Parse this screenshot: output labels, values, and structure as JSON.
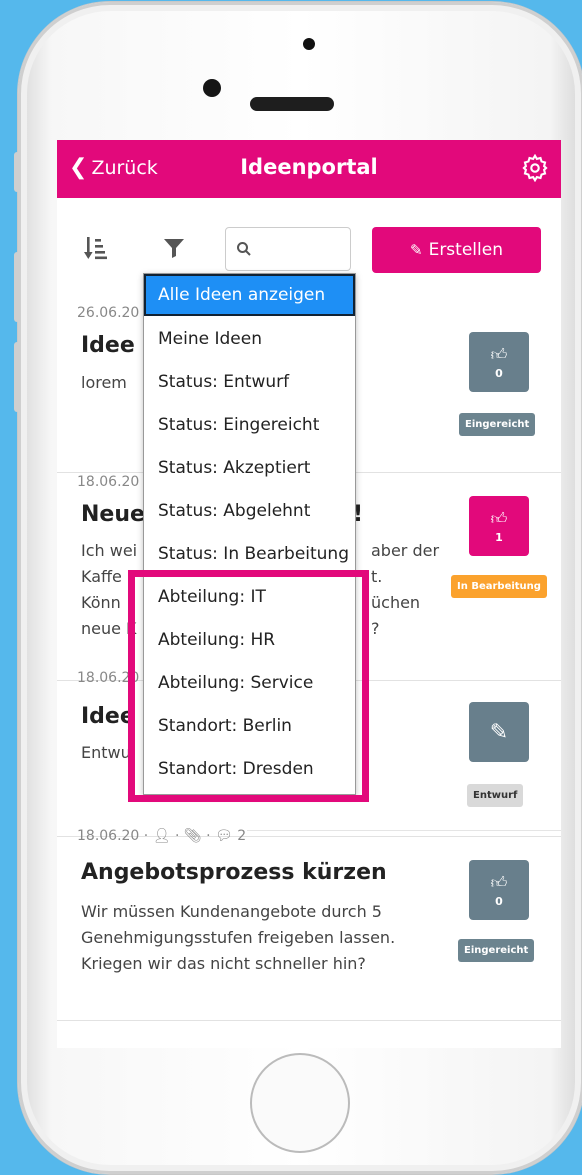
{
  "header": {
    "back_label": "Zurück",
    "title": "Ideenportal"
  },
  "toolbar": {
    "search_placeholder": "",
    "create_label": "Erstellen"
  },
  "filter_menu": {
    "items": [
      "Alle Ideen anzeigen",
      "Meine Ideen",
      "Status: Entwurf",
      "Status: Eingereicht",
      "Status: Akzeptiert",
      "Status: Abgelehnt",
      "Status: In Bearbeitung",
      "Abteilung: IT",
      "Abteilung: HR",
      "Abteilung: Service",
      "Standort: Berlin",
      "Standort: Dresden"
    ],
    "active_index": 0
  },
  "ideas": [
    {
      "date": "26.06.20",
      "title": "Idee r",
      "text": "lorem",
      "votes": "0",
      "status": "Eingereicht"
    },
    {
      "date": "18.06.20",
      "title": "Neue",
      "title_end": "!",
      "text1_start": "Ich wei",
      "text1_end": "aber der",
      "text2_start": "Kaffe",
      "text2_end": "t.",
      "text3_start": "Könn",
      "text3_end": "üchen",
      "text4_start": "neue K",
      "text4_end": "?",
      "votes": "1",
      "status": "In Bearbeitung"
    },
    {
      "date": "18.06.20",
      "title": "Idee",
      "text": "Entwu",
      "status": "Entwurf"
    },
    {
      "date": "18.06.20",
      "comments": "2",
      "title": "Angebotsprozess kürzen",
      "text": "Wir müssen Kundenangebote durch 5 Genehmigungsstufen freigeben lassen. Kriegen wir das nicht schneller hin?",
      "votes": "0",
      "status": "Eingereicht"
    }
  ],
  "colors": {
    "brand": "#e2097b",
    "accent_blue": "#1e8ff5",
    "vote_gray": "#687f8c",
    "status_orange": "#fba22d",
    "background": "#55b8ec"
  }
}
